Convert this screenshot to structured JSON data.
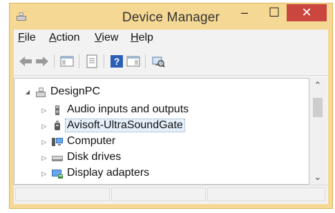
{
  "window": {
    "title": "Device Manager",
    "minimize_glyph": "–",
    "maximize_glyph": "☐",
    "close_glyph": "✕"
  },
  "menu": {
    "items": [
      {
        "u": "F",
        "rest": "ile"
      },
      {
        "u": "A",
        "rest": "ction"
      },
      {
        "u": "V",
        "rest": "iew"
      },
      {
        "u": "H",
        "rest": "elp"
      }
    ]
  },
  "toolbar": {
    "buttons": [
      "back-arrow-icon",
      "forward-arrow-icon",
      "show-hide-console-tree-icon",
      "properties-icon",
      "help-icon",
      "action-pane-icon",
      "scan-hardware-icon"
    ]
  },
  "tree": {
    "root": {
      "label": "DesignPC",
      "expander": "◢"
    },
    "children": [
      {
        "label": "Audio inputs and outputs",
        "expander": "▷",
        "icon": "speaker-icon"
      },
      {
        "label": "Avisoft-UltraSoundGate",
        "expander": "▷",
        "icon": "usb-device-icon",
        "selected": true
      },
      {
        "label": "Computer",
        "expander": "▷",
        "icon": "computer-icon"
      },
      {
        "label": "Disk drives",
        "expander": "▷",
        "icon": "disk-drive-icon"
      },
      {
        "label": "Display adapters",
        "expander": "▷",
        "icon": "display-adapter-icon"
      }
    ]
  },
  "scrollbar": {
    "up_glyph": "⌃",
    "down_glyph": "⌄"
  },
  "colors": {
    "frame": "#f5d893",
    "close_button": "#c9473f",
    "selection_bg": "#e5f0fb"
  }
}
